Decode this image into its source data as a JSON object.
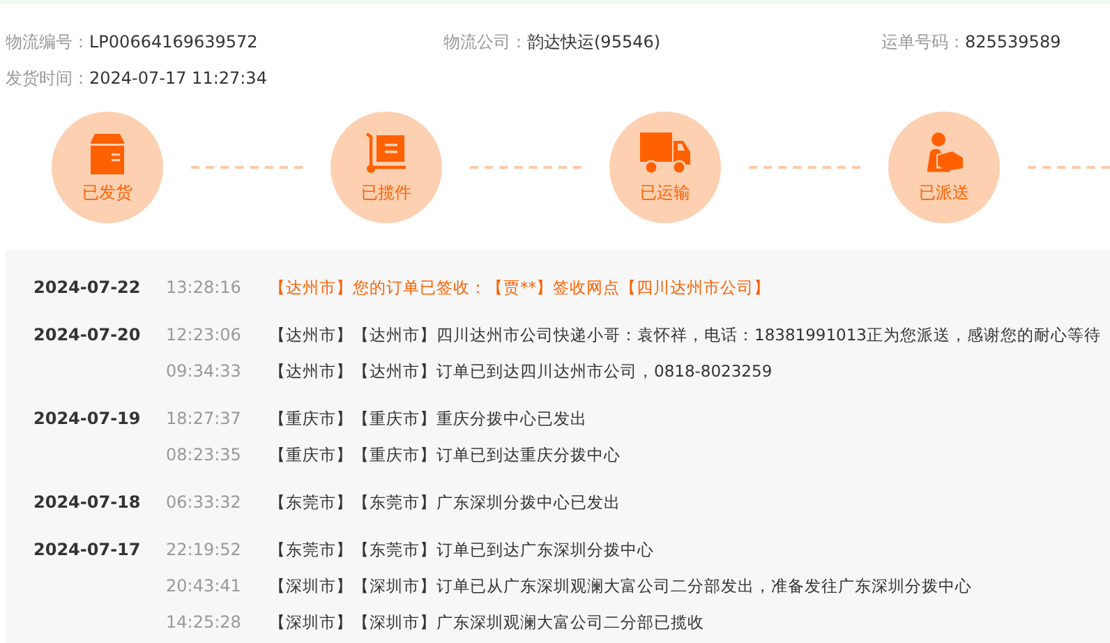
{
  "info": [
    {
      "label": "物流编号：",
      "value": "LP00664169639572"
    },
    {
      "label": "物流公司：",
      "value": "韵达快运(95546)"
    },
    {
      "label": "运单号码：",
      "value": "825539589"
    },
    {
      "label": "发货时间：",
      "value": "2024-07-17 11:27:34"
    }
  ],
  "stages": [
    {
      "label": "已发货"
    },
    {
      "label": "已揽件"
    },
    {
      "label": "已运输"
    },
    {
      "label": "已派送"
    }
  ],
  "timeline": [
    {
      "date": "2024-07-22",
      "entries": [
        {
          "time": "13:28:16",
          "text": "【达州市】您的订单已签收：【贾**】签收网点【四川达州市公司】",
          "highlight": true
        }
      ]
    },
    {
      "date": "2024-07-20",
      "entries": [
        {
          "time": "12:23:06",
          "text": "【达州市】【达州市】四川达州市公司快递小哥：袁怀祥，电话：18381991013正为您派送，感谢您的耐心等待",
          "highlight": false
        },
        {
          "time": "09:34:33",
          "text": "【达州市】【达州市】订单已到达四川达州市公司，0818-8023259",
          "highlight": false
        }
      ]
    },
    {
      "date": "2024-07-19",
      "entries": [
        {
          "time": "18:27:37",
          "text": "【重庆市】【重庆市】重庆分拨中心已发出",
          "highlight": false
        },
        {
          "time": "08:23:35",
          "text": "【重庆市】【重庆市】订单已到达重庆分拨中心",
          "highlight": false
        }
      ]
    },
    {
      "date": "2024-07-18",
      "entries": [
        {
          "time": "06:33:32",
          "text": "【东莞市】【东莞市】广东深圳分拨中心已发出",
          "highlight": false
        }
      ]
    },
    {
      "date": "2024-07-17",
      "entries": [
        {
          "time": "22:19:52",
          "text": "【东莞市】【东莞市】订单已到达广东深圳分拨中心",
          "highlight": false
        },
        {
          "time": "20:43:41",
          "text": "【深圳市】【深圳市】订单已从广东深圳观澜大富公司二分部发出，准备发往广东深圳分拨中心",
          "highlight": false
        },
        {
          "time": "14:25:28",
          "text": "【深圳市】【深圳市】广东深圳观澜大富公司二分部已揽收",
          "highlight": false
        }
      ]
    }
  ]
}
